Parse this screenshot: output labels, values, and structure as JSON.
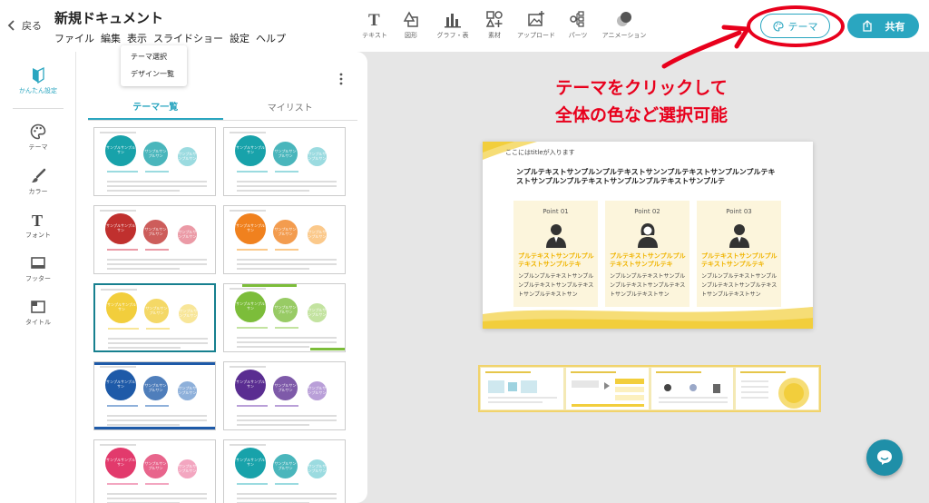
{
  "topbar": {
    "back_label": "戻る",
    "doc_title": "新規ドキュメント",
    "menus": [
      "ファイル",
      "編集",
      "表示",
      "スライドショー",
      "設定",
      "ヘルプ"
    ],
    "tools": [
      {
        "icon": "text-T-icon",
        "label": "テキスト"
      },
      {
        "icon": "shape-icon",
        "label": "図形"
      },
      {
        "icon": "chart-icon",
        "label": "グラフ・表"
      },
      {
        "icon": "material-icon",
        "label": "素材"
      },
      {
        "icon": "upload-image-icon",
        "label": "アップロード"
      },
      {
        "icon": "parts-icon",
        "label": "パーツ"
      },
      {
        "icon": "animation-icon",
        "label": "アニメーション"
      }
    ],
    "theme_label": "テーマ",
    "share_label": "共有",
    "accent_color": "#2aa6c0",
    "highlight_color": "#e8001c"
  },
  "view_dropdown": {
    "items": [
      "テーマ選択",
      "デザイン一覧"
    ]
  },
  "sidebar": {
    "items": [
      {
        "icon": "beginner-mark-icon",
        "label": "かんたん設定",
        "active": true
      },
      {
        "icon": "palette-icon",
        "label": "テーマ"
      },
      {
        "icon": "brush-icon",
        "label": "カラー"
      },
      {
        "icon": "font-T-icon",
        "label": "フォント"
      },
      {
        "icon": "footer-icon",
        "label": "フッター"
      },
      {
        "icon": "title-icon",
        "label": "タイトル"
      }
    ]
  },
  "theme_panel": {
    "tabs": [
      "テーマ一覧",
      "マイリスト"
    ],
    "active_tab": 0,
    "themes": [
      {
        "color": "#18a2aa",
        "light": "#9bdbe0"
      },
      {
        "color": "#18a2aa",
        "light": "#9bdbe0"
      },
      {
        "color": "#c0302e",
        "light": "#eb9aa6"
      },
      {
        "color": "#f0811e",
        "light": "#fbc98b"
      },
      {
        "color": "#f2ce3c",
        "light": "#f8e699",
        "selected": true
      },
      {
        "color": "#7cbd3a",
        "light": "#c3e3a0"
      },
      {
        "color": "#1e5aa8",
        "light": "#8eb0da"
      },
      {
        "color": "#5a2d91",
        "light": "#b99fd8"
      },
      {
        "color": "#e23a6c",
        "light": "#f3a6c0"
      },
      {
        "color": "#18a2aa",
        "light": "#9bdbe0"
      }
    ],
    "circle_label": "サンプルサンプルサン"
  },
  "annotation": {
    "line1": "テーマをクリックして",
    "line2": "全体の色など選択可能"
  },
  "slide": {
    "title": "ここにはtitleが入ります",
    "heading": "ンプルテキストサンプルンプルテキストサンンプルテキストサンプルンプルテキストサンプルンプルテキストサンプルンプルテキストサンプルテ",
    "points": [
      {
        "title": "Point 01",
        "highlight": "プルテキストサンプルプルテキストサンプルテキ",
        "body": "ンプルンプルテキストサンプルンプルテキストサンプルテキストサンプルテキストサン",
        "person": "man"
      },
      {
        "title": "Point 02",
        "highlight": "プルテキストサンプルプルテキストサンプルテキ",
        "body": "ンプルンプルテキストサンプルンプルテキストサンプルテキストサンプルテキストサン",
        "person": "woman"
      },
      {
        "title": "Point 03",
        "highlight": "プルテキストサンプルプルテキストサンプルテキ",
        "body": "ンプルンプルテキストサンプルンプルテキストサンプルテキストサンプルテキストサン",
        "person": "man"
      }
    ],
    "accent": "#f2ce3c"
  },
  "slide_strip": {
    "count": 4
  }
}
